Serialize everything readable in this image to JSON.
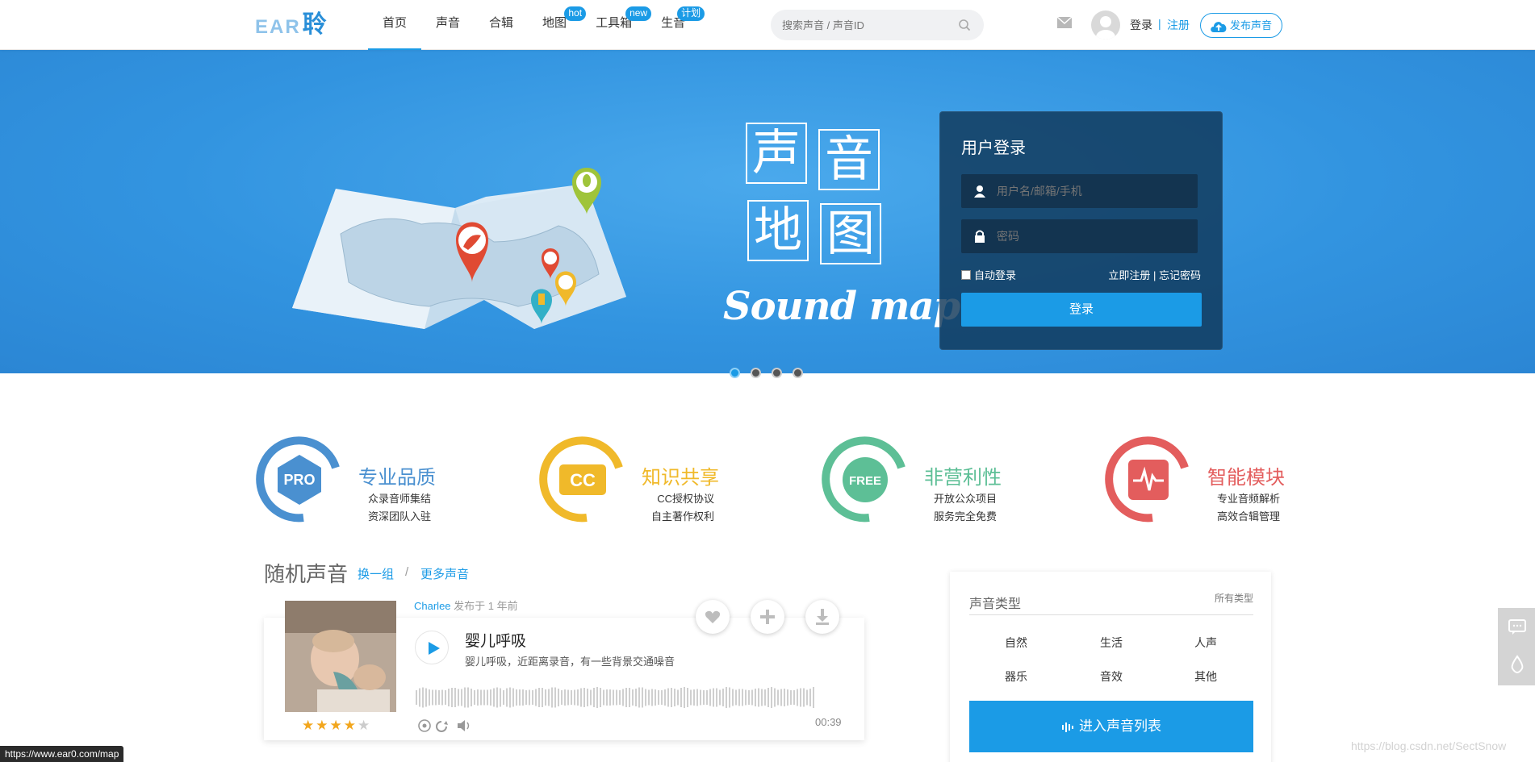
{
  "header": {
    "logo": {
      "ear": "EAR",
      "ling": "聆"
    },
    "nav": [
      {
        "label": "首页",
        "badge": ""
      },
      {
        "label": "声音",
        "badge": ""
      },
      {
        "label": "合辑",
        "badge": ""
      },
      {
        "label": "地图",
        "badge": "hot"
      },
      {
        "label": "工具箱",
        "badge": "new"
      },
      {
        "label": "生音",
        "badge": "计划"
      }
    ],
    "search_placeholder": "搜索声音 / 声音ID",
    "login": "登录",
    "separator": "|",
    "register": "注册",
    "publish": "发布声音"
  },
  "banner": {
    "title_chars": [
      "声",
      "音",
      "地",
      "图"
    ],
    "subtitle": "Sound map",
    "login_box": {
      "title": "用户登录",
      "username_placeholder": "用户名/邮箱/手机",
      "password_placeholder": "密码",
      "auto_login": "自动登录",
      "register_now": "立即注册",
      "link_sep": "|",
      "forgot": "忘记密码",
      "submit": "登录"
    },
    "slides": 4,
    "active_slide": 1
  },
  "features": [
    {
      "icon": "PRO",
      "name": "专业品质",
      "line1": "众录音师集结",
      "line2": "资深团队入驻",
      "color": "#4a90d0"
    },
    {
      "icon": "CC",
      "name": "知识共享",
      "line1": "CC授权协议",
      "line2": "自主著作权利",
      "color": "#f0b92a"
    },
    {
      "icon": "FREE",
      "name": "非营利性",
      "line1": "开放公众项目",
      "line2": "服务完全免费",
      "color": "#5dbf96"
    },
    {
      "icon": "pulse",
      "name": "智能模块",
      "line1": "专业音频解析",
      "line2": "高效合辑管理",
      "color": "#e35d5d"
    }
  ],
  "random": {
    "title": "随机声音",
    "swap": "换一组",
    "slash": "/",
    "more": "更多声音",
    "card": {
      "author": "Charlee",
      "published": "发布于 1 年前",
      "name": "婴儿呼吸",
      "desc": "婴儿呼吸，近距离录音，有一些背景交通噪音",
      "duration": "00:39",
      "rating": 4,
      "rating_max": 5
    }
  },
  "types": {
    "title": "声音类型",
    "all": "所有类型",
    "items": [
      "自然",
      "生活",
      "人声",
      "器乐",
      "音效",
      "其他"
    ],
    "enter": "进入声音列表"
  },
  "status_url": "https://www.ear0.com/map",
  "watermark": "https://blog.csdn.net/SectSnow",
  "colors": {
    "accent": "#1b9be6",
    "banner": "#3294e0"
  }
}
